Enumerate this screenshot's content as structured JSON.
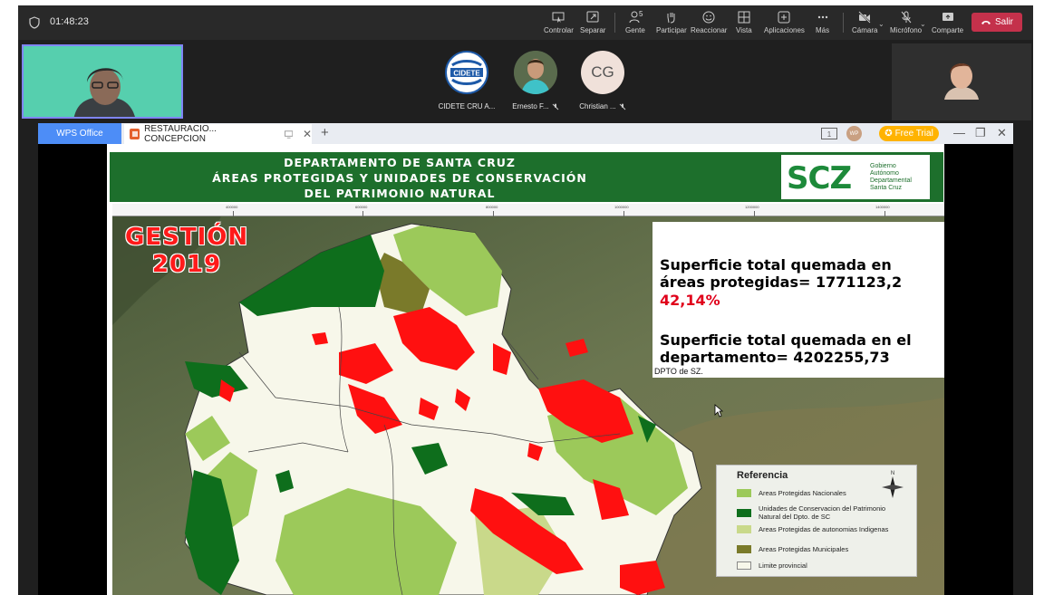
{
  "topbar": {
    "elapsed": "01:48:23",
    "buttons": [
      {
        "label": "Controlar",
        "icon": "control-icon"
      },
      {
        "label": "Separar",
        "icon": "popout-icon"
      },
      {
        "label": "Gente",
        "icon": "people-icon",
        "count": "5"
      },
      {
        "label": "Participar",
        "icon": "hand-icon"
      },
      {
        "label": "Reaccionar",
        "icon": "smile-icon"
      },
      {
        "label": "Vista",
        "icon": "grid-icon"
      },
      {
        "label": "Aplicaciones",
        "icon": "apps-icon"
      },
      {
        "label": "Más",
        "icon": "more-icon"
      },
      {
        "label": "Cámara",
        "icon": "camera-off-icon"
      },
      {
        "label": "Micrófono",
        "icon": "mic-off-icon"
      },
      {
        "label": "Comparte",
        "icon": "share-icon"
      }
    ],
    "leave_label": "Salir",
    "leave_color": "#c4314b"
  },
  "participants": [
    {
      "name": "CIDETE CRU A...",
      "avatar": "CIDETE"
    },
    {
      "name": "Ernesto F...",
      "avatar": ""
    },
    {
      "name": "Christian ...",
      "avatar": "CG"
    }
  ],
  "wps": {
    "home_tab": "WPS Office",
    "doc_tab": "RESTAURACIO... CONCEPCION",
    "free_trial": "Free Trial",
    "user_badge": "WP"
  },
  "slide": {
    "header_lines": [
      "DEPARTAMENTO DE SANTA CRUZ",
      "ÁREAS PROTEGIDAS Y UNIDADES DE CONSERVACIÓN",
      "DEL PATRIMONIO NATURAL"
    ],
    "logo_text": "SCZ",
    "logo_sub": [
      "Gobierno",
      "Autónomo",
      "Departamental",
      "Santa Cruz"
    ],
    "gestion_line1": "GESTIÓN",
    "gestion_line2": "2019",
    "stat1": "Superficie total quemada en áreas protegidas= 1771123,2",
    "stat1_pct": "42,14%",
    "stat2": "Superficie total quemada en el departamento= 4202255,73",
    "stat_footer": "DPTO de SZ.",
    "ruler_labels": [
      "400000",
      "600000",
      "800000",
      "1000000",
      "1200000",
      "1400000"
    ],
    "legend": {
      "title": "Referencia",
      "north": "N",
      "items": [
        {
          "label": "Areas Protegidas Nacionales",
          "color": "#9cc95a"
        },
        {
          "label": "Unidades de Conservacion del Patrimonio Natural del Dpto. de SC",
          "color": "#0e6e1c"
        },
        {
          "label": "Areas Protegidas de autonomias Indigenas",
          "color": "#c9d98a"
        },
        {
          "label": "Areas Protegidas Municipales",
          "color": "#7a7a2a"
        },
        {
          "label": "Limite provincial",
          "color": "#f7f7ea"
        }
      ]
    }
  }
}
